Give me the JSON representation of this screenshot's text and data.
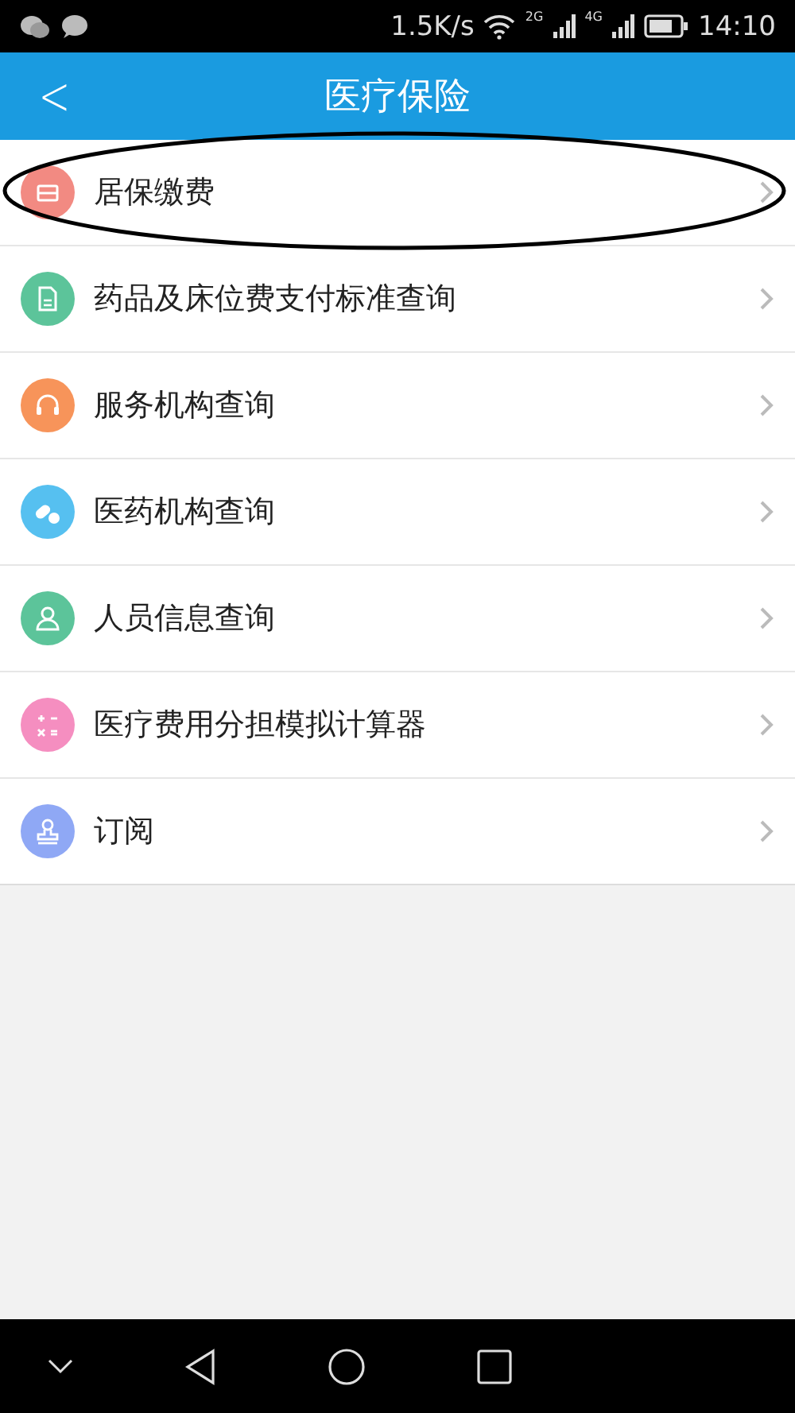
{
  "status_bar": {
    "speed": "1.5K/s",
    "network_1": "2G",
    "network_2": "4G",
    "time": "14:10"
  },
  "header": {
    "back": "<",
    "title": "医疗保险"
  },
  "items": [
    {
      "label": "居保缴费",
      "color": "#f28a82",
      "highlighted": true
    },
    {
      "label": "药品及床位费支付标准查询",
      "color": "#5cc49a",
      "highlighted": false
    },
    {
      "label": "服务机构查询",
      "color": "#f7945a",
      "highlighted": false
    },
    {
      "label": "医药机构查询",
      "color": "#56c0f0",
      "highlighted": false
    },
    {
      "label": "人员信息查询",
      "color": "#5cc49a",
      "highlighted": false
    },
    {
      "label": "医疗费用分担模拟计算器",
      "color": "#f58ec0",
      "highlighted": false
    },
    {
      "label": "订阅",
      "color": "#8fa8f5",
      "highlighted": false
    }
  ]
}
